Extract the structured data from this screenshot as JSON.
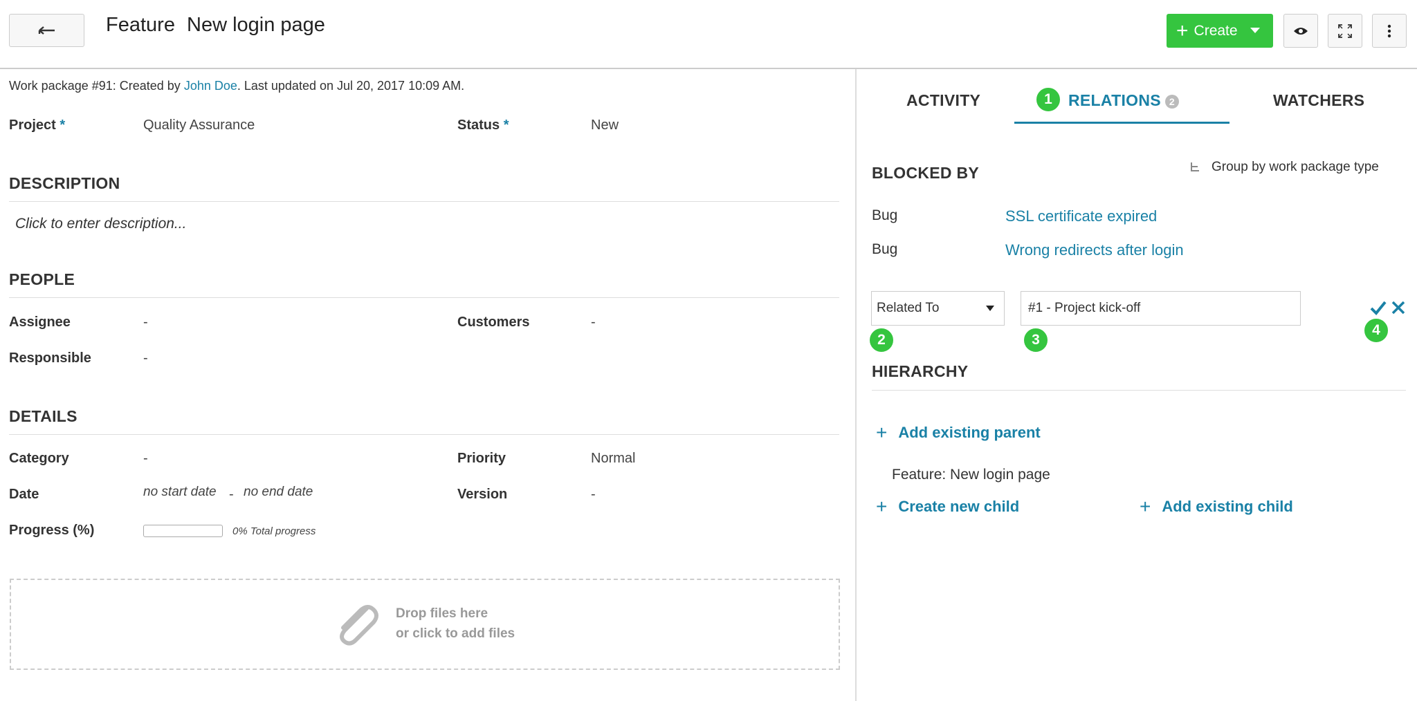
{
  "header": {
    "type": "Feature",
    "subject": "New login page",
    "create_label": "Create"
  },
  "meta": {
    "prefix": "Work package #91: Created by ",
    "author": "John Doe",
    "suffix": ". Last updated on Jul 20, 2017 10:09 AM."
  },
  "overview": {
    "project_label": "Project",
    "project_value": "Quality Assurance",
    "status_label": "Status",
    "status_value": "New",
    "required_mark": "*"
  },
  "description": {
    "heading": "DESCRIPTION",
    "placeholder": "Click to enter description..."
  },
  "people": {
    "heading": "PEOPLE",
    "assignee_label": "Assignee",
    "assignee_value": "-",
    "customers_label": "Customers",
    "customers_value": "-",
    "responsible_label": "Responsible",
    "responsible_value": "-"
  },
  "details": {
    "heading": "DETAILS",
    "category_label": "Category",
    "category_value": "-",
    "priority_label": "Priority",
    "priority_value": "Normal",
    "date_label": "Date",
    "start_date": "no start date",
    "date_separator": "-",
    "end_date": "no end date",
    "version_label": "Version",
    "version_value": "-",
    "progress_label": "Progress (%)",
    "progress_value": 0,
    "progress_text": "0% Total progress"
  },
  "attachments": {
    "line1": "Drop files here",
    "line2": "or click to add files"
  },
  "tabs": {
    "activity": "ACTIVITY",
    "relations": "RELATIONS",
    "relations_count": "2",
    "watchers": "WATCHERS"
  },
  "relations": {
    "blocked_by_heading": "BLOCKED BY",
    "group_by_label": "Group by work package type",
    "items": [
      {
        "type": "Bug",
        "title": "SSL certificate expired"
      },
      {
        "type": "Bug",
        "title": "Wrong redirects after login"
      }
    ],
    "relation_type_selected": "Related To",
    "relation_target_value": "#1 - Project kick-off"
  },
  "hierarchy": {
    "heading": "HIERARCHY",
    "add_parent": "Add existing parent",
    "current": "Feature: New login page",
    "create_child": "Create new child",
    "add_child": "Add existing child"
  },
  "markers": [
    "1",
    "2",
    "3",
    "4"
  ],
  "colors": {
    "accent": "#1a81a6",
    "create_green": "#35c53f"
  }
}
